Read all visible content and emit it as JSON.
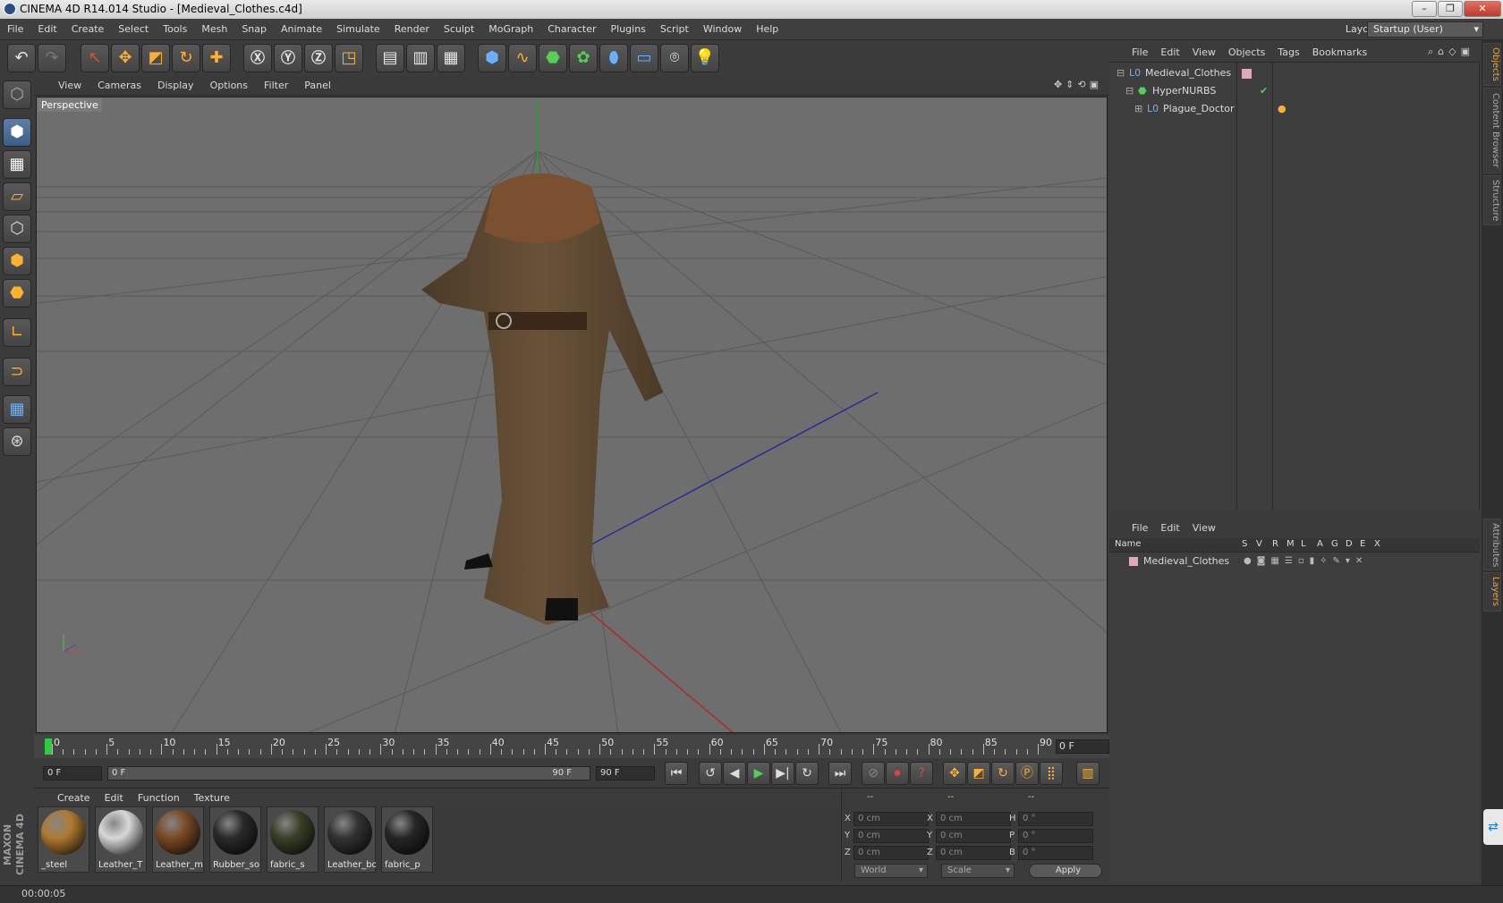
{
  "window": {
    "title": "CINEMA 4D R14.014 Studio - [Medieval_Clothes.c4d]",
    "min": "–",
    "max": "❐",
    "close": "✕"
  },
  "menu": [
    "File",
    "Edit",
    "Create",
    "Select",
    "Tools",
    "Mesh",
    "Snap",
    "Animate",
    "Simulate",
    "Render",
    "Sculpt",
    "MoGraph",
    "Character",
    "Plugins",
    "Script",
    "Window",
    "Help"
  ],
  "layout": {
    "label": "Layout:",
    "value": "Startup (User)"
  },
  "viewport": {
    "menu": [
      "View",
      "Cameras",
      "Display",
      "Options",
      "Filter",
      "Panel"
    ],
    "label": "Perspective"
  },
  "timeline": {
    "ticks": [
      "0",
      "5",
      "10",
      "15",
      "20",
      "25",
      "30",
      "35",
      "40",
      "45",
      "50",
      "55",
      "60",
      "65",
      "70",
      "75",
      "80",
      "85",
      "90"
    ],
    "current": "0 F"
  },
  "transport": {
    "start": "0 F",
    "range_start": "0 F",
    "range_end": "90 F",
    "end": "90 F"
  },
  "materials": {
    "menu": [
      "Create",
      "Edit",
      "Function",
      "Texture"
    ],
    "items": [
      {
        "name": "_steel",
        "color": "#b07a30"
      },
      {
        "name": "Leather_T",
        "color": "#d8d8d8"
      },
      {
        "name": "Leather_m",
        "color": "#7a4a25"
      },
      {
        "name": "Rubber_so",
        "color": "#2a2a2a"
      },
      {
        "name": "fabric_s",
        "color": "#3a4028"
      },
      {
        "name": "Leather_bo",
        "color": "#333333"
      },
      {
        "name": "fabric_p",
        "color": "#262626"
      }
    ]
  },
  "coords": {
    "headers": [
      "--",
      "--",
      "--"
    ],
    "rows": [
      {
        "a": "X",
        "av": "0 cm",
        "b": "X",
        "bv": "0 cm",
        "c": "H",
        "cv": "0 °"
      },
      {
        "a": "Y",
        "av": "0 cm",
        "b": "Y",
        "bv": "0 cm",
        "c": "P",
        "cv": "0 °"
      },
      {
        "a": "Z",
        "av": "0 cm",
        "b": "Z",
        "bv": "0 cm",
        "c": "B",
        "cv": "0 °"
      }
    ],
    "world": "World",
    "scale": "Scale",
    "apply": "Apply"
  },
  "objects": {
    "menu": [
      "File",
      "Edit",
      "View",
      "Objects",
      "Tags",
      "Bookmarks"
    ],
    "tree": [
      {
        "name": "Medieval_Clothes",
        "indent": 0
      },
      {
        "name": "HyperNURBS",
        "indent": 1
      },
      {
        "name": "Plague_Doctor",
        "indent": 2
      }
    ]
  },
  "layers": {
    "menu": [
      "File",
      "Edit",
      "View"
    ],
    "columns": [
      "Name",
      "S",
      "V",
      "R",
      "M",
      "L",
      "A",
      "G",
      "D",
      "E",
      "X"
    ],
    "rows": [
      {
        "name": "Medieval_Clothes"
      }
    ]
  },
  "righttabs": [
    "Objects",
    "Content Browser",
    "Structure",
    "Attributes",
    "Layers"
  ],
  "status": "00:00:05",
  "brand": "MAXON CINEMA 4D"
}
